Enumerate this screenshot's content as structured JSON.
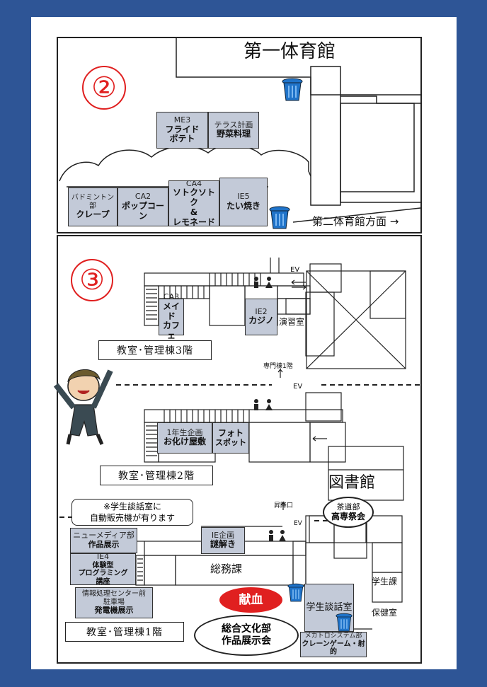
{
  "colors": {
    "frame": "#2e5596",
    "room_fill": "#c3cad8",
    "highlight_red": "#e02020",
    "trash_blue": "#1f73c9"
  },
  "area2": {
    "marker": "②",
    "gym1": "第一体育館",
    "gym2_direction": "第二体育館方面 →",
    "rooms": [
      {
        "code": "ME3",
        "name_line1": "フライド",
        "name_line2": "ポテト"
      },
      {
        "code": "テラス計画",
        "name_line1": "野菜料理",
        "name_line2": ""
      },
      {
        "code": "バドミントン部",
        "name_line1": "クレープ",
        "name_line2": ""
      },
      {
        "code": "CA2",
        "name_line1": "ポップコーン",
        "name_line2": ""
      },
      {
        "code": "CA4",
        "name_line1": "ソトクソトク",
        "name_line2": "&",
        "name_line3": "レモネード"
      },
      {
        "code": "IE5",
        "name_line1": "たい焼き",
        "name_line2": ""
      }
    ]
  },
  "area3": {
    "marker": "③",
    "floor3_label": "教室･管理棟3階",
    "floor2_label": "教室･管理棟2階",
    "floor1_label": "教室･管理棟1階",
    "ev": "EV",
    "senmon_label": "専門棟1階",
    "shokouguchi": "昇降口",
    "enshu": "演習室",
    "library": "図書館",
    "somu": "総務課",
    "gakusei_ka": "学生課",
    "hoken": "保健室",
    "danwa": "学生談話室",
    "kenketsu": "献血",
    "note_line1": "※学生談話室に",
    "note_line2": "自動販売機が有ります",
    "rooms3": [
      {
        "code": "CA3",
        "line1": "メイド",
        "line2": "カフェ"
      },
      {
        "code": "IE2",
        "line1": "カジノ",
        "line2": ""
      }
    ],
    "rooms2": [
      {
        "code": "1年生企画",
        "line1": "お化け屋敷"
      },
      {
        "code": "",
        "line1": "フォト",
        "line2": "スポット"
      }
    ],
    "rooms1": [
      {
        "code": "ニューメディア部",
        "line1": "作品展示"
      },
      {
        "code": "IE企画",
        "line1": "謎解き"
      },
      {
        "code": "IE4",
        "line1": "体験型",
        "line2": "プログラミング",
        "line3": "講座"
      },
      {
        "code": "情報処理センター前",
        "code2": "駐車場",
        "line1": "発電機展示"
      },
      {
        "code": "メカトロシステム部",
        "line1": "クレーンゲーム・射的"
      }
    ],
    "tea_bubble": {
      "line1": "茶道部",
      "line2": "高専祭会"
    },
    "culture_bubble": {
      "line1": "総合文化部",
      "line2": "作品展示会"
    }
  }
}
